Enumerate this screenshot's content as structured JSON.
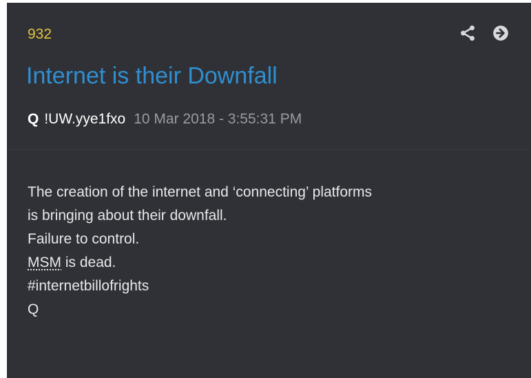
{
  "post": {
    "number": "932",
    "title": "Internet is their Downfall",
    "author": "Q",
    "tripcode": "!UW.yye1fxo",
    "timestamp": "10 Mar 2018 - 3:55:31 PM",
    "body": {
      "line1": "The creation of the internet and ‘connecting’ platforms",
      "line2": "is bringing about their downfall.",
      "line3": "Failure to control.",
      "line4_abbr": "MSM",
      "line4_rest": " is dead.",
      "line5": "#internetbillofrights",
      "line6": "Q"
    }
  },
  "icons": {
    "share": "share-icon",
    "go": "arrow-right-circle-icon"
  },
  "colors": {
    "background": "#303136",
    "number": "#e3c33a",
    "title": "#2f8fd1",
    "timestamp": "#9a9ba1",
    "text": "#e8e8ea"
  }
}
